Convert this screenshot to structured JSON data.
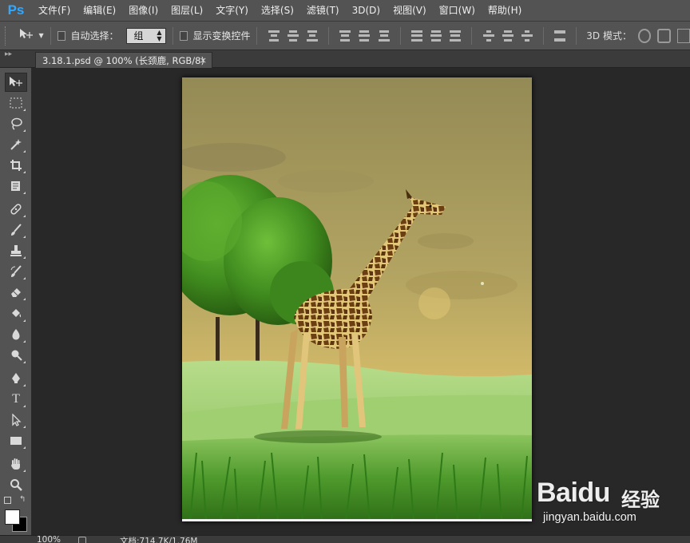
{
  "app": {
    "logo": "Ps"
  },
  "menu": [
    "文件(F)",
    "编辑(E)",
    "图像(I)",
    "图层(L)",
    "文字(Y)",
    "选择(S)",
    "滤镜(T)",
    "3D(D)",
    "视图(V)",
    "窗口(W)",
    "帮助(H)"
  ],
  "options": {
    "auto_select_label": "自动选择：",
    "auto_select_value": "组",
    "show_transform_label": "显示变换控件",
    "mode_3d_label": "3D 模式："
  },
  "document": {
    "tab_title": "3.18.1.psd @ 100% (长颈鹿, RGB/8)",
    "close_symbol": "×"
  },
  "tools": [
    "move-tool",
    "marquee-tool",
    "lasso-tool",
    "magic-wand-tool",
    "crop-tool",
    "eyedropper-tool",
    "healing-brush-tool",
    "brush-tool",
    "clone-stamp-tool",
    "history-brush-tool",
    "eraser-tool",
    "paint-bucket-tool",
    "blur-tool",
    "dodge-tool",
    "pen-tool",
    "type-tool",
    "path-selection-tool",
    "rectangle-tool",
    "hand-tool",
    "zoom-tool"
  ],
  "colors": {
    "foreground": "#ffffff",
    "background": "#000000",
    "ui_panel": "#535353",
    "workspace": "#282828",
    "ps_blue": "#31a8ff"
  },
  "status": {
    "zoom": "100%",
    "doc_info": "文档:714.7K/1.76M"
  },
  "watermark": {
    "brand": "Baidu",
    "cn": "经验",
    "url": "jingyan.baidu.com"
  }
}
